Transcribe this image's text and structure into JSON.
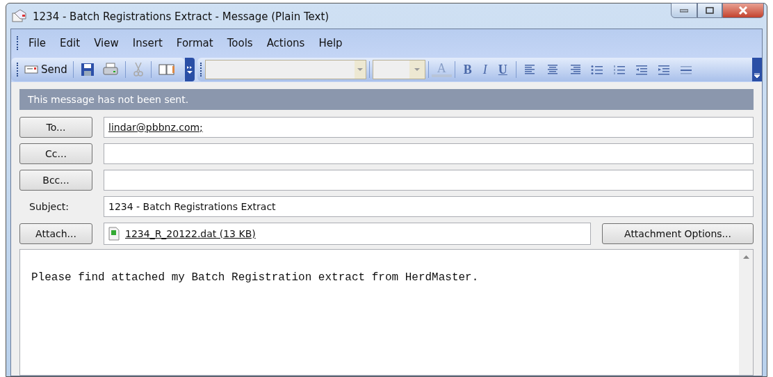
{
  "window": {
    "title": "1234 - Batch Registrations Extract - Message (Plain Text)"
  },
  "menu": [
    "File",
    "Edit",
    "View",
    "Insert",
    "Format",
    "Tools",
    "Actions",
    "Help"
  ],
  "toolbar": {
    "send": "Send",
    "font_buttons": [
      {
        "label": "A",
        "kind": "color"
      },
      {
        "label": "B",
        "kind": "bold"
      },
      {
        "label": "I",
        "kind": "italic"
      },
      {
        "label": "U",
        "kind": "underline"
      }
    ]
  },
  "info_bar": "This message has not been sent.",
  "fields": [
    {
      "kind": "button",
      "label": "To...",
      "value": "lindar@pbbnz.com;"
    },
    {
      "kind": "button",
      "label": "Cc..."
    },
    {
      "kind": "button",
      "label": "Bcc..."
    },
    {
      "kind": "label",
      "label": "Subject:",
      "value": "1234 - Batch Registrations Extract"
    }
  ],
  "attach": {
    "label": "Attach...",
    "file": "1234_R_20122.dat (13 KB)",
    "options": "Attachment Options..."
  },
  "body": "Please find attached my Batch Registration extract from HerdMaster."
}
